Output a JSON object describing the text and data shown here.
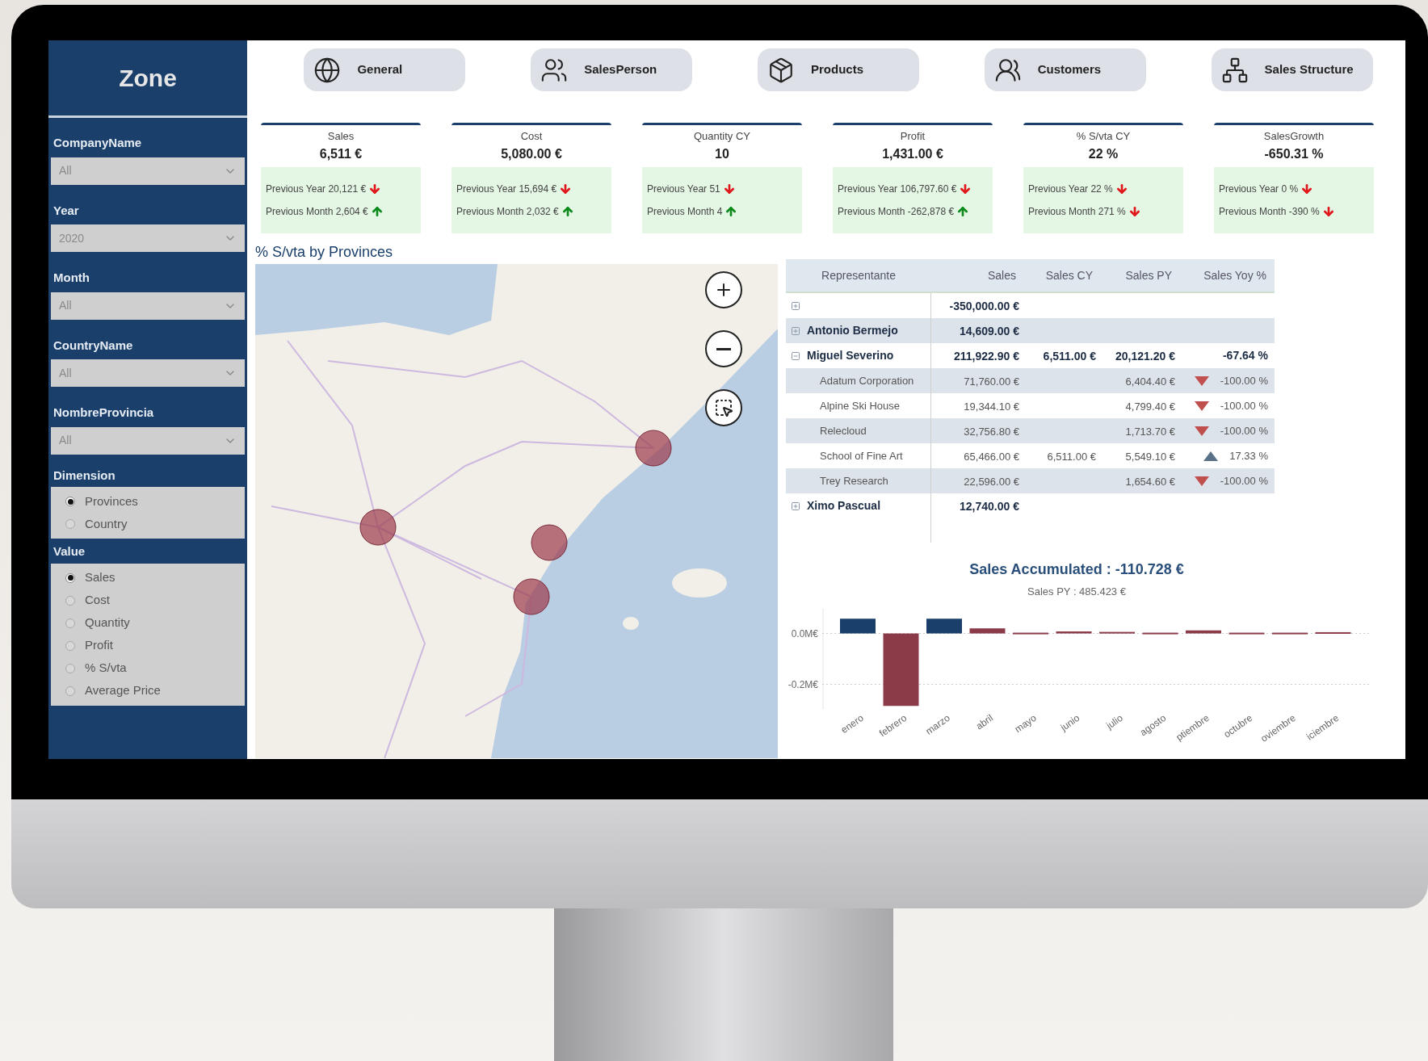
{
  "sidebar": {
    "title": "Zone",
    "filters": [
      {
        "label": "CompanyName",
        "value": "All"
      },
      {
        "label": "Year",
        "value": "2020"
      },
      {
        "label": "Month",
        "value": "All"
      },
      {
        "label": "CountryName",
        "value": "All"
      },
      {
        "label": "NombreProvincia",
        "value": "All"
      }
    ],
    "radio_groups": [
      {
        "label": "Dimension",
        "options": [
          {
            "label": "Provinces",
            "selected": true
          },
          {
            "label": "Country",
            "selected": false
          }
        ]
      },
      {
        "label": "Value",
        "options": [
          {
            "label": "Sales",
            "selected": true
          },
          {
            "label": "Cost",
            "selected": false
          },
          {
            "label": "Quantity",
            "selected": false
          },
          {
            "label": "Profit",
            "selected": false
          },
          {
            "label": "% S/vta",
            "selected": false
          },
          {
            "label": "Average Price",
            "selected": false
          }
        ]
      }
    ]
  },
  "nav": [
    {
      "label": "General",
      "kind": "globe"
    },
    {
      "label": "SalesPerson",
      "kind": "salesperson"
    },
    {
      "label": "Products",
      "kind": "products"
    },
    {
      "label": "Customers",
      "kind": "customers"
    },
    {
      "label": "Sales Structure",
      "kind": "structure"
    }
  ],
  "kpis": [
    {
      "title": "Sales",
      "value": "6,511 €",
      "previous_year": {
        "text": "Previous Year 20,121 €",
        "rising": false
      },
      "previous_month": {
        "text": "Previous Month 2,604 €",
        "rising": true
      }
    },
    {
      "title": "Cost",
      "value": "5,080.00 €",
      "previous_year": {
        "text": "Previous Year 15,694 €",
        "rising": false
      },
      "previous_month": {
        "text": "Previous Month 2,032 €",
        "rising": true
      }
    },
    {
      "title": "Quantity CY",
      "value": "10",
      "previous_year": {
        "text": "Previous Year 51",
        "rising": false
      },
      "previous_month": {
        "text": "Previous Month 4",
        "rising": true
      }
    },
    {
      "title": "Profit",
      "value": "1,431.00 €",
      "previous_year": {
        "text": "Previous Year 106,797.60 €",
        "rising": false
      },
      "previous_month": {
        "text": "Previous Month -262,878 €",
        "rising": true
      }
    },
    {
      "title": "% S/vta CY",
      "value": "22 %",
      "previous_year": {
        "text": "Previous Year 22 %",
        "rising": false
      },
      "previous_month": {
        "text": "Previous Month 271 %",
        "rising": false
      }
    },
    {
      "title": "SalesGrowth",
      "value": "-650.31 %",
      "previous_year": {
        "text": "Previous Year 0 %",
        "rising": false
      },
      "previous_month": {
        "text": "Previous Month -390 %",
        "rising": false
      }
    }
  ],
  "map": {
    "title": "% S/vta by Provinces"
  },
  "table": {
    "columns": [
      "Representante",
      "Sales",
      "Sales CY",
      "Sales PY",
      "Sales Yoy %"
    ],
    "rows": [
      {
        "expanded": false,
        "sales": "-350,000.00 €"
      },
      {
        "name": "Antonio Bermejo",
        "expanded": false,
        "sales": "14,609.00 €"
      },
      {
        "name": "Miguel Severino",
        "expanded": true,
        "sales": "211,922.90 €",
        "sales_cy": "6,511.00 €",
        "sales_py": "20,121.20 €",
        "yoy": "-67.64 %",
        "children": [
          {
            "name": "Adatum Corporation",
            "sales": "71,760.00 €",
            "sales_py": "6,404.40 €",
            "rising": false,
            "yoy": "-100.00 %"
          },
          {
            "name": "Alpine Ski House",
            "sales": "19,344.10 €",
            "sales_py": "4,799.40 €",
            "rising": false,
            "yoy": "-100.00 %"
          },
          {
            "name": "Relecloud",
            "sales": "32,756.80 €",
            "sales_py": "1,713.70 €",
            "rising": false,
            "yoy": "-100.00 %"
          },
          {
            "name": "School of Fine Art",
            "sales": "65,466.00 €",
            "sales_cy": "6,511.00 €",
            "sales_py": "5,549.10 €",
            "rising": true,
            "yoy": "17.33 %"
          },
          {
            "name": "Trey Research",
            "sales": "22,596.00 €",
            "sales_py": "1,654.60 €",
            "rising": false,
            "yoy": "-100.00 %"
          }
        ]
      },
      {
        "name": "Ximo Pascual",
        "expanded": false,
        "sales": "12,740.00 €"
      }
    ]
  },
  "chart": {
    "title": "Sales Accumulated : -110.728 €",
    "subtitle": "Sales PY : 485.423 €",
    "chart_data": {
      "type": "bar",
      "categories": [
        "enero",
        "febrero",
        "marzo",
        "abril",
        "mayo",
        "junio",
        "julio",
        "agosto",
        "ptiembre",
        "octubre",
        "oviembre",
        "iciembre"
      ],
      "series": [
        {
          "color": "#1b3f6b",
          "values": [
            0.058,
            null,
            0.058,
            null,
            null,
            null,
            null,
            null,
            null,
            null,
            null,
            null
          ]
        },
        {
          "color": "#8b3a48",
          "values": [
            null,
            -0.285,
            null,
            0.02,
            0.003,
            0.008,
            0.006,
            0.003,
            0.012,
            0.003,
            0.003,
            0.005
          ]
        }
      ],
      "ylim": [
        -0.3,
        0.1
      ],
      "yticks": [
        {
          "value": 0,
          "label": "0.0M€"
        },
        {
          "value": -0.2,
          "label": "-0.2M€"
        }
      ]
    }
  }
}
